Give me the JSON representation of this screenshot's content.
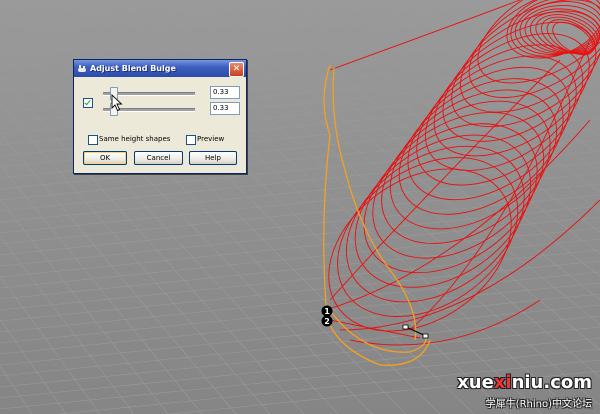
{
  "dialog": {
    "title": "Adjust Blend Bulge",
    "close_glyph": "✕",
    "lock_checked": true,
    "slider1": {
      "value": 0.33,
      "text": "0.33"
    },
    "slider2": {
      "value": 0.33,
      "text": "0.33"
    },
    "same_height": {
      "label": "Same height shapes",
      "checked": false
    },
    "preview": {
      "label": "Preview",
      "checked": false
    },
    "buttons": {
      "ok": "OK",
      "cancel": "Cancel",
      "help": "Help"
    }
  },
  "viewport": {
    "point_labels": [
      "1",
      "2"
    ],
    "curve_color": "#e81010",
    "profile_color": "#f5a020",
    "grid_color": "#9a9a9a"
  },
  "watermark": {
    "prefix": "xue",
    "accent": "xi",
    "suffix": "niu.com",
    "subtitle": "学犀牛(Rhino)中文论坛"
  },
  "icons": [
    "rhino-app-icon",
    "close-icon",
    "mouse-cursor-icon"
  ]
}
